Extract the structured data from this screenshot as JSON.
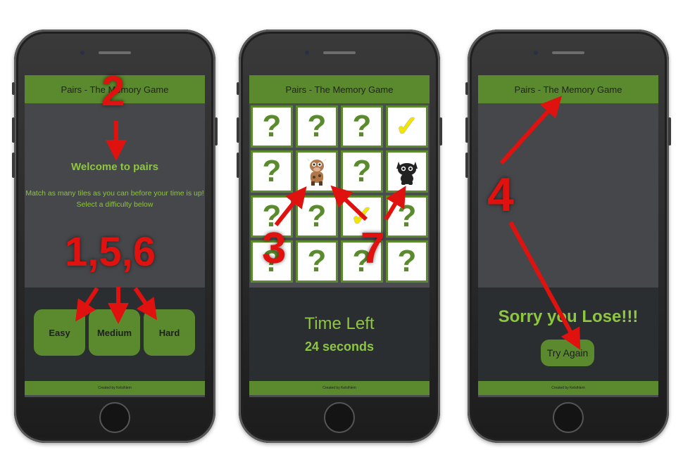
{
  "app_title": "Pairs - The Memory Game",
  "footer_text": "Created by Kelsihlem",
  "screen1": {
    "welcome": "Welcome to pairs",
    "instructions_line1": "Match as many tiles as you can before your time is up!",
    "instructions_line2": "Select a difficulty below",
    "buttons": [
      "Easy",
      "Medium",
      "Hard"
    ]
  },
  "screen2": {
    "tiles": [
      "?",
      "?",
      "?",
      "check",
      "?",
      "cow",
      "?",
      "cat",
      "?",
      "?",
      "check",
      "?",
      "?",
      "?",
      "?",
      "?"
    ],
    "time_label": "Time Left",
    "time_value": "24 seconds"
  },
  "screen3": {
    "message": "Sorry you Lose!!!",
    "try_again": "Try Again"
  },
  "annotations": {
    "a2": "2",
    "a156": "1,5,6",
    "a3": "3",
    "a7": "7",
    "a4": "4"
  },
  "colors": {
    "accent": "#5b8a2e",
    "text_green": "#8dc63f",
    "annotation_red": "#e0120f"
  }
}
